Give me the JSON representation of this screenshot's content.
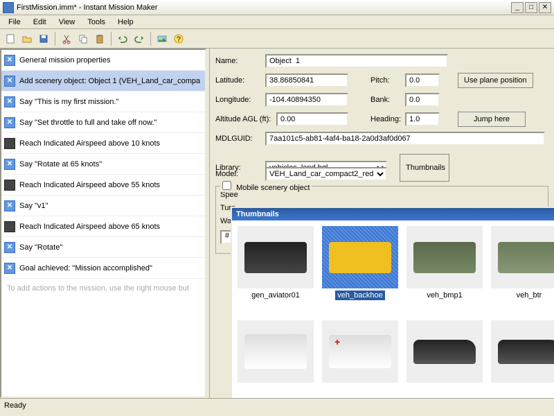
{
  "window": {
    "title": "FirstMission.imm* - Instant Mission Maker"
  },
  "menus": [
    "File",
    "Edit",
    "View",
    "Tools",
    "Help"
  ],
  "left": {
    "items": [
      {
        "icon": "x",
        "text": "General mission properties"
      },
      {
        "icon": "x",
        "text": "Add scenery object: Object  1 (VEH_Land_car_compa",
        "selected": true
      },
      {
        "icon": "x",
        "text": "Say \"This is my first mission.\""
      },
      {
        "icon": "x",
        "text": "Say \"Set throttle to full and take off now.\""
      },
      {
        "icon": "arrow",
        "text": "Reach Indicated Airspeed above 10 knots"
      },
      {
        "icon": "x",
        "text": "Say \"Rotate at 65 knots\""
      },
      {
        "icon": "arrow",
        "text": "Reach Indicated Airspeed above 55 knots"
      },
      {
        "icon": "x",
        "text": "Say \"v1\""
      },
      {
        "icon": "arrow",
        "text": "Reach Indicated Airspeed above 65 knots"
      },
      {
        "icon": "x",
        "text": "Say \"Rotate\""
      },
      {
        "icon": "x",
        "text": "Goal achieved: \"Mission accomplished\""
      }
    ],
    "hint": "To add actions to the mission, use the right mouse but"
  },
  "form": {
    "labels": {
      "name": "Name:",
      "lat": "Latitude:",
      "lon": "Longitude:",
      "alt": "Altitude AGL (ft):",
      "pitch": "Pitch:",
      "bank": "Bank:",
      "heading": "Heading:",
      "mdlguid": "MDLGUID:",
      "library": "Library:",
      "model": "Model:",
      "mobile": "Mobile scenery object",
      "speed": "Spee",
      "turn": "Turn",
      "wayp": "Wayp"
    },
    "values": {
      "name": "Object  1",
      "lat": "38.86850841",
      "lon": "-104.40894350",
      "alt": "0.00",
      "pitch": "0.0",
      "bank": "0.0",
      "heading": "1.0",
      "guid": "7aa101c5-ab81-4af4-ba18-2a0d3af0d067",
      "library": "vehicles_land.bgl",
      "model": "VEH_Land_car_compact2_red",
      "wpnum": "#"
    },
    "buttons": {
      "useplane": "Use plane position",
      "jump": "Jump here",
      "thumbnails": "Thumbnails"
    }
  },
  "thumbnails": {
    "title": "Thumbnails",
    "row1": [
      {
        "label": "gen_aviator01",
        "cls": "suv"
      },
      {
        "label": "veh_backhoe",
        "cls": "backhoe",
        "selected": true
      },
      {
        "label": "veh_bmp1",
        "cls": "bmp"
      },
      {
        "label": "veh_btr",
        "cls": "btr"
      }
    ],
    "row2": [
      {
        "label": "",
        "cls": "bus"
      },
      {
        "label": "",
        "cls": "amb"
      },
      {
        "label": "",
        "cls": "car"
      },
      {
        "label": "",
        "cls": "car"
      }
    ]
  },
  "status": "Ready"
}
